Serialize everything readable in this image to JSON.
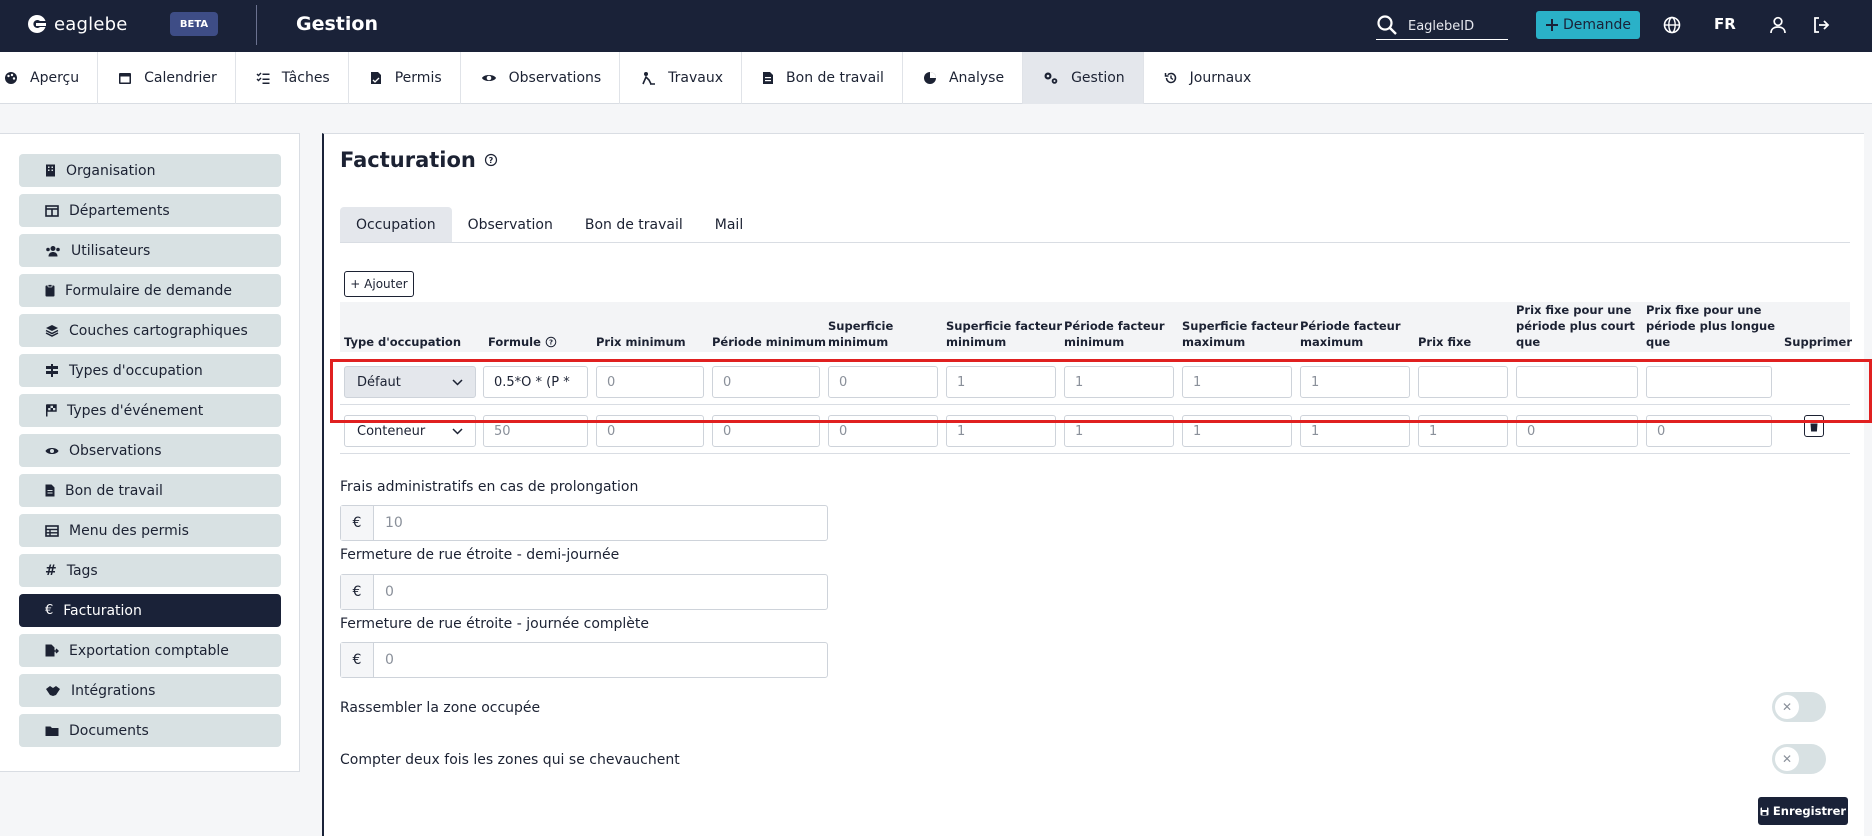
{
  "app": {
    "logo_text": "eaglebe",
    "badge": "BETA",
    "title": "Gestion"
  },
  "topbar": {
    "search": {
      "placeholder": "EaglebeID",
      "icon": "search-icon"
    },
    "new_button_label": "Demande",
    "language": "FR",
    "icons": [
      "globe-icon",
      "user-icon",
      "logout-icon"
    ]
  },
  "nav": {
    "items": [
      {
        "label": "Aperçu",
        "icon": "palette-icon"
      },
      {
        "label": "Calendrier",
        "icon": "calendar-icon"
      },
      {
        "label": "Tâches",
        "icon": "tasks-icon"
      },
      {
        "label": "Permis",
        "icon": "permit-icon"
      },
      {
        "label": "Observations",
        "icon": "eye-icon"
      },
      {
        "label": "Travaux",
        "icon": "roadwork-icon"
      },
      {
        "label": "Bon de travail",
        "icon": "document-icon"
      },
      {
        "label": "Analyse",
        "icon": "chart-icon"
      },
      {
        "label": "Gestion",
        "icon": "gears-icon",
        "active": true
      },
      {
        "label": "Journaux",
        "icon": "history-icon"
      }
    ]
  },
  "sidebar": {
    "items": [
      {
        "label": "Organisation",
        "icon": "building-icon"
      },
      {
        "label": "Départements",
        "icon": "columns-icon"
      },
      {
        "label": "Utilisateurs",
        "icon": "users-icon"
      },
      {
        "label": "Formulaire de demande",
        "icon": "clipboard-icon"
      },
      {
        "label": "Couches cartographiques",
        "icon": "layers-icon"
      },
      {
        "label": "Types d'occupation",
        "icon": "signs-icon"
      },
      {
        "label": "Types d'événement",
        "icon": "flag-icon"
      },
      {
        "label": "Observations",
        "icon": "eye-icon"
      },
      {
        "label": "Bon de travail",
        "icon": "document-icon"
      },
      {
        "label": "Menu des permis",
        "icon": "table-icon"
      },
      {
        "label": "Tags",
        "icon": "hashtag-icon"
      },
      {
        "label": "Facturation",
        "icon": "euro-icon",
        "active": true
      },
      {
        "label": "Exportation comptable",
        "icon": "file-export-icon"
      },
      {
        "label": "Intégrations",
        "icon": "handshake-icon"
      },
      {
        "label": "Documents",
        "icon": "folder-icon"
      }
    ]
  },
  "main": {
    "title": "Facturation",
    "tabs": [
      "Occupation",
      "Observation",
      "Bon de travail",
      "Mail"
    ],
    "add_button": "+ Ajouter",
    "columns": [
      [
        "Type d'occupation"
      ],
      [
        "Formule"
      ],
      [
        "Prix minimum"
      ],
      [
        "Période minimum"
      ],
      [
        "Superficie",
        "minimum"
      ],
      [
        "Superficie facteur",
        "minimum"
      ],
      [
        "Période facteur",
        "minimum"
      ],
      [
        "Superficie facteur",
        "maximum"
      ],
      [
        "Période facteur",
        "maximum"
      ],
      [
        "Prix fixe"
      ],
      [
        "Prix fixe pour une",
        "période plus court",
        "que"
      ],
      [
        "Prix fixe pour une",
        "période plus longue",
        "que"
      ],
      [
        "Supprimer"
      ]
    ],
    "rows": [
      {
        "type": "Défaut",
        "formula": "0.5*O * (P  *",
        "values": [
          "0",
          "0",
          "0",
          "1",
          "1",
          "1",
          "1",
          "",
          "",
          ""
        ],
        "highlighted": true
      },
      {
        "type": "Conteneur",
        "formula": "50",
        "values": [
          "0",
          "0",
          "0",
          "1",
          "1",
          "1",
          "1",
          "1",
          "0",
          "0"
        ],
        "highlighted": false
      }
    ],
    "fees": [
      {
        "label": "Frais administratifs en cas de prolongation",
        "currency": "€",
        "value": "10"
      },
      {
        "label": "Fermeture de rue étroite - demi-journée",
        "currency": "€",
        "value": "0"
      },
      {
        "label": "Fermeture de rue étroite - journée complète",
        "currency": "€",
        "value": "0"
      }
    ],
    "toggles": [
      {
        "label": "Rassembler la zone occupée",
        "checked": false
      },
      {
        "label": "Compter deux fois les zones qui se chevauchent",
        "checked": false
      }
    ],
    "save_button": "Enregistrer"
  },
  "colors": {
    "navy": "#1a2238",
    "accent": "#2ab1c8",
    "sidebar_item": "#d8e1e3",
    "highlight": "#e02020"
  }
}
